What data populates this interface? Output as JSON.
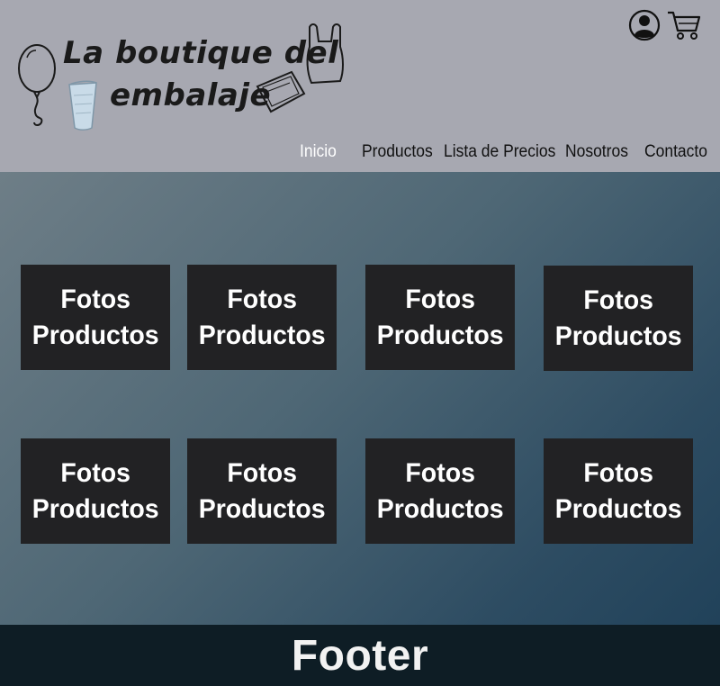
{
  "header": {
    "logo": {
      "line1": "La boutique del",
      "line2": "embalaje"
    },
    "icons": {
      "account": "user-circle-icon",
      "cart": "shopping-cart-icon"
    },
    "nav": [
      {
        "label": "Inicio",
        "active": true
      },
      {
        "label": "Productos",
        "active": false
      },
      {
        "label": "Lista de Precios",
        "active": false
      },
      {
        "label": "Nosotros",
        "active": false
      },
      {
        "label": "Contacto",
        "active": false
      }
    ]
  },
  "main": {
    "products": [
      {
        "label": "Fotos\nProductos"
      },
      {
        "label": "Fotos\nProductos"
      },
      {
        "label": "Fotos\nProductos"
      },
      {
        "label": "Fotos\nProductos"
      },
      {
        "label": "Fotos\nProductos"
      },
      {
        "label": "Fotos\nProductos"
      },
      {
        "label": "Fotos\nProductos"
      },
      {
        "label": "Fotos\nProductos"
      }
    ]
  },
  "footer": {
    "label": "Footer"
  },
  "colors": {
    "header_bg": "#a7a8b1",
    "card_bg": "#222224",
    "footer_bg": "#0e1d25",
    "nav_active": "#ffffff"
  }
}
